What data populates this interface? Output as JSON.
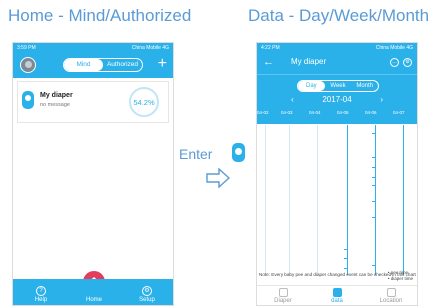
{
  "headings": {
    "left": "Home - Mind/Authorized",
    "right": "Data - Day/Week/Month"
  },
  "home_phone": {
    "status": {
      "time": "3:59 PM",
      "right": "China Mobile 4G"
    },
    "segments": [
      "Mind",
      "Authorized"
    ],
    "active_segment": "Mind",
    "card": {
      "title": "My diaper",
      "subtitle": "no message",
      "percent": "54.2%"
    },
    "tabs": {
      "help": "Help",
      "home": "Home",
      "setup": "Setup"
    }
  },
  "transition": {
    "label": "Enter"
  },
  "data_phone": {
    "status": {
      "time": "4:22 PM",
      "right": "China Mobile 4G"
    },
    "title": "My diaper",
    "segments": [
      "Day",
      "Week",
      "Month"
    ],
    "active_segment": "Day",
    "month": "2017-04",
    "dates": [
      "04-02",
      "04-03",
      "04-04",
      "04-05",
      "04-06",
      "04-07"
    ],
    "note": "Note: Every baby pee and diaper changed event can be checked in this chart",
    "legend": [
      "pee time",
      "diaper time"
    ],
    "tabs": {
      "diaper": "Diaper",
      "data": "data",
      "location": "Location"
    }
  },
  "colors": {
    "accent": "#2bb1ea",
    "heading": "#5b9bd5",
    "home_button": "#e43c5c"
  }
}
